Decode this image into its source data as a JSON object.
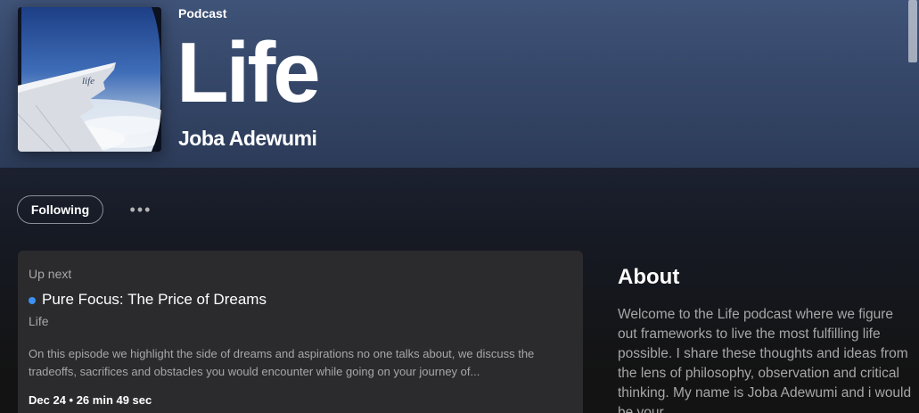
{
  "header": {
    "type_label": "Podcast",
    "title": "Life",
    "author": "Joba Adewumi",
    "cover_image": "airplane-wing-window-icon",
    "cover_text": "life"
  },
  "actions": {
    "follow_label": "Following",
    "more_label": "•••"
  },
  "up_next": {
    "label": "Up next",
    "episode_title": "Pure Focus: The Price of Dreams",
    "show_name": "Life",
    "description": "On this episode we highlight the side of dreams and aspirations no one talks about, we discuss the tradeoffs, sacrifices and obstacles you would encounter while going on your journey of...",
    "meta": "Dec 24 • 26 min 49 sec",
    "status_color": "#3d91f4"
  },
  "about": {
    "heading": "About",
    "text": "Welcome to the Life podcast where we figure out frameworks to live the most fulfilling life possible. I share these thoughts and ideas from the lens of philosophy, observation and critical thinking. My name is Joba Adewumi and i would be your"
  },
  "colors": {
    "header_top": "#3f5378",
    "background": "#121212",
    "card": "#2b2b2d",
    "accent_dot": "#3d91f4"
  }
}
